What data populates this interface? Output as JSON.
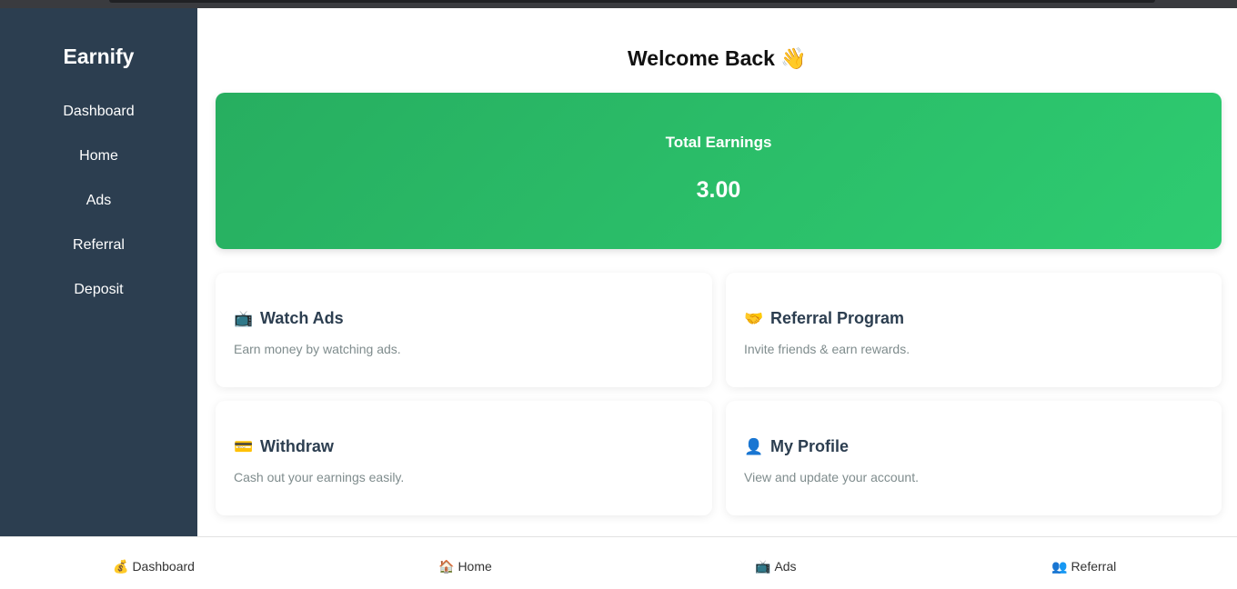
{
  "sidebar": {
    "brand": "Earnify",
    "items": [
      {
        "label": "Dashboard"
      },
      {
        "label": "Home"
      },
      {
        "label": "Ads"
      },
      {
        "label": "Referral"
      },
      {
        "label": "Deposit"
      }
    ]
  },
  "main": {
    "welcome": "Welcome Back 👋",
    "earnings": {
      "label": "Total Earnings",
      "value": "3.00",
      "gradient_colors": [
        "#27ae60",
        "#2ecc71"
      ]
    },
    "cards": [
      {
        "icon": "📺",
        "icon_name": "tv-icon",
        "title": "Watch Ads",
        "desc": "Earn money by watching ads."
      },
      {
        "icon": "🤝",
        "icon_name": "handshake-icon",
        "title": "Referral Program",
        "desc": "Invite friends & earn rewards."
      },
      {
        "icon": "💳",
        "icon_name": "credit-card-icon",
        "title": "Withdraw",
        "desc": "Cash out your earnings easily."
      },
      {
        "icon": "👤",
        "icon_name": "user-icon",
        "title": "My Profile",
        "desc": "View and update your account."
      }
    ]
  },
  "bottom_nav": {
    "items": [
      {
        "icon": "💰",
        "icon_name": "money-bag-icon",
        "label": "Dashboard"
      },
      {
        "icon": "🏠",
        "icon_name": "home-icon",
        "label": "Home"
      },
      {
        "icon": "📺",
        "icon_name": "tv-icon",
        "label": "Ads"
      },
      {
        "icon": "👥",
        "icon_name": "users-icon",
        "label": "Referral"
      }
    ]
  },
  "colors": {
    "sidebar_bg": "#2c3e50",
    "accent": "#2ecc71",
    "card_title": "#2c3e50",
    "card_desc": "#7f8c8d"
  }
}
